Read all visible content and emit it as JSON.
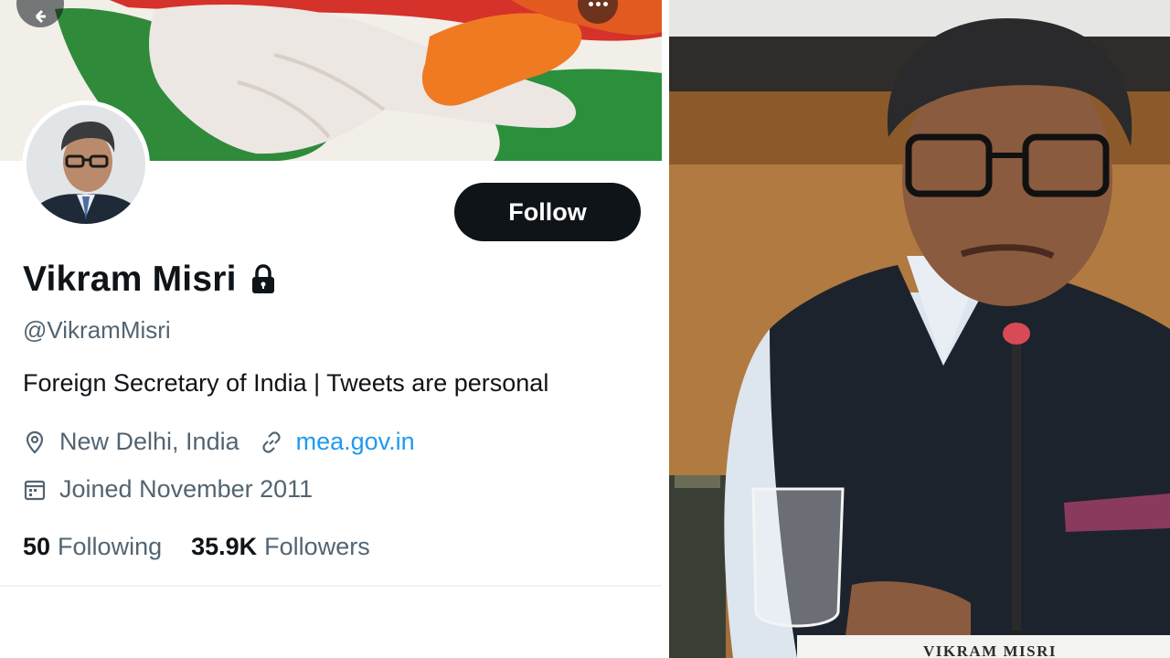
{
  "profile": {
    "display_name": "Vikram Misri",
    "handle": "@VikramMisri",
    "bio": "Foreign Secretary of India | Tweets are personal",
    "location": "New Delhi, India",
    "website": "mea.gov.in",
    "joined": "Joined November 2011",
    "following_count": "50",
    "following_label": "Following",
    "followers_count": "35.9K",
    "followers_label": "Followers",
    "follow_label": "Follow",
    "verified_lock": "lock-icon"
  },
  "icons": {
    "back": "arrow-left-icon",
    "more": "more-dots-icon",
    "location": "location-pin-icon",
    "link": "link-icon",
    "calendar": "calendar-icon"
  },
  "photo": {
    "nameplate": "VIKRAM MISRI"
  },
  "colors": {
    "button_bg": "#0f1419",
    "primary_text": "#0f1419",
    "secondary_text": "#536471",
    "link": "#1d9bf0",
    "divider": "#eff3f4"
  }
}
